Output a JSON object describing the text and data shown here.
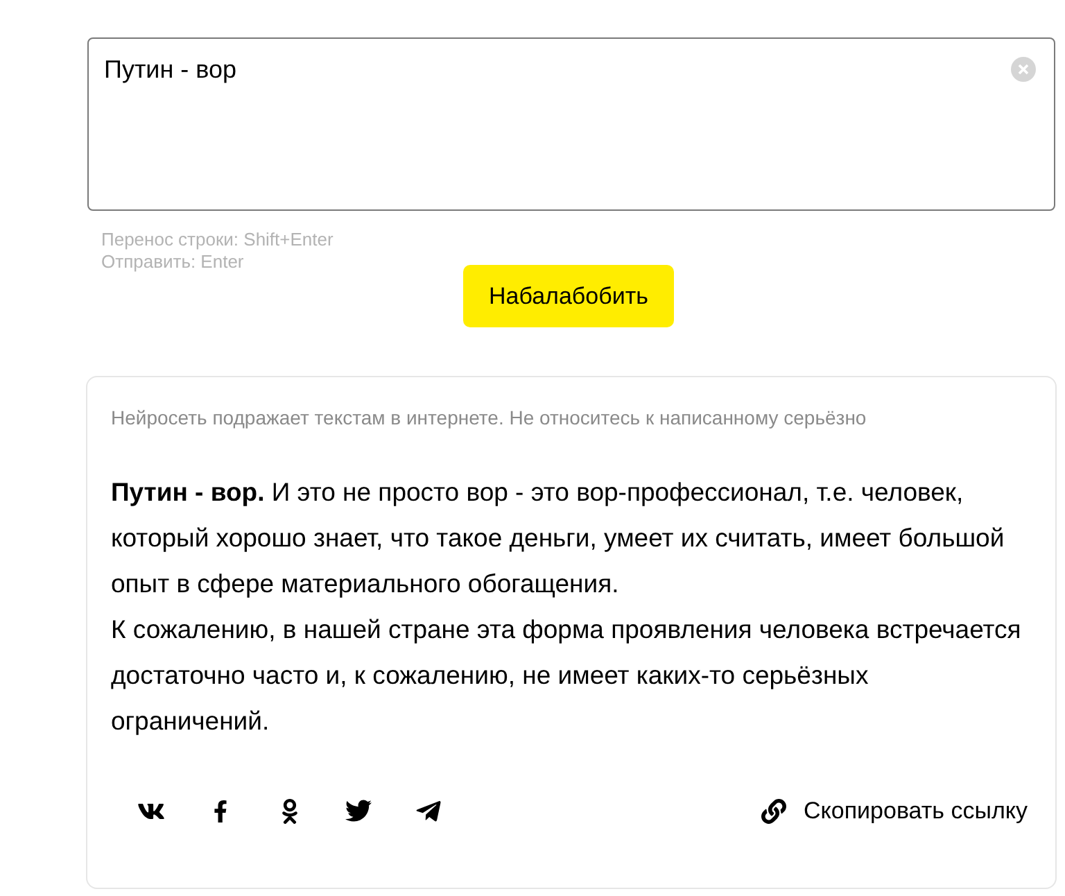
{
  "input": {
    "value": "Путин - вор"
  },
  "hints": [
    "Перенос строки: Shift+Enter",
    "Отправить: Enter"
  ],
  "submit_button": "Набалабобить",
  "result": {
    "disclaimer": "Нейросеть подражает текстам в интернете. Не относитесь к написанному серьёзно",
    "paragraphs": [
      "**Путин - вор.** И это не просто вор - это вор-профессионал, т.е. человек, который хорошо знает, что такое деньги, умеет их считать, имеет большой опыт в сфере материального обогащения.",
      "К сожалению, в нашей стране эта форма проявления человека встречается достаточно часто и, к сожалению, не имеет каких-то серьёзных ограничений."
    ],
    "share": [
      {
        "kind": "vk"
      },
      {
        "kind": "facebook"
      },
      {
        "kind": "odnoklassniki"
      },
      {
        "kind": "twitter"
      },
      {
        "kind": "telegram"
      }
    ],
    "copy_link": "Скопировать ссылку"
  }
}
